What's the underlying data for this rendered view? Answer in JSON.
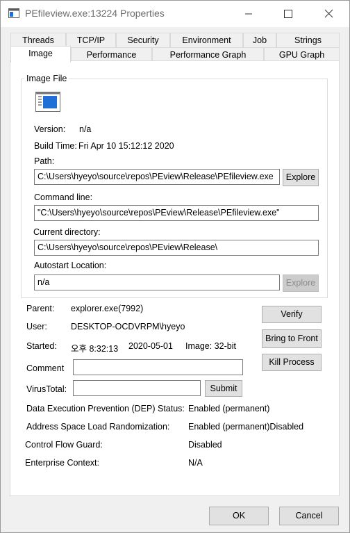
{
  "window": {
    "title": "PEfileview.exe:13224 Properties"
  },
  "tabs_row1": [
    "Threads",
    "TCP/IP",
    "Security",
    "Environment",
    "Job",
    "Strings"
  ],
  "tabs_row2": [
    "Image",
    "Performance",
    "Performance Graph",
    "GPU Graph"
  ],
  "image_file": {
    "group_title": "Image File",
    "version_label": "Version:",
    "version_value": "n/a",
    "build_time_label": "Build Time:",
    "build_time_value": "Fri Apr 10 15:12:12 2020",
    "path_label": "Path:",
    "path_value": "C:\\Users\\hyeyo\\source\\repos\\PEview\\Release\\PEfileview.exe",
    "explore_label": "Explore",
    "command_line_label": "Command line:",
    "command_line_value": "\"C:\\Users\\hyeyo\\source\\repos\\PEview\\Release\\PEfileview.exe\"",
    "current_dir_label": "Current directory:",
    "current_dir_value": "C:\\Users\\hyeyo\\source\\repos\\PEview\\Release\\",
    "autostart_label": "Autostart Location:",
    "autostart_value": "n/a",
    "autostart_explore_label": "Explore"
  },
  "process": {
    "parent_label": "Parent:",
    "parent_value": "explorer.exe(7992)",
    "user_label": "User:",
    "user_value": "DESKTOP-OCDVRPM\\hyeyo",
    "started_label": "Started:",
    "started_time": "오후 8:32:13",
    "started_date": "2020-05-01",
    "image_bits": "Image: 32-bit",
    "comment_label": "Comment",
    "comment_value": "",
    "virustotal_label": "VirusTotal:",
    "virustotal_value": "",
    "submit_label": "Submit",
    "verify_label": "Verify",
    "bring_to_front_label": "Bring to Front",
    "kill_process_label": "Kill Process"
  },
  "security": {
    "dep_label": "Data Execution Prevention (DEP) Status:",
    "dep_value": "Enabled (permanent)",
    "aslr_label": "Address Space Load Randomization:",
    "aslr_value": "Enabled (permanent)Disabled",
    "cfg_label": "Control Flow Guard:",
    "cfg_value": "Disabled",
    "enterprise_label": "Enterprise Context:",
    "enterprise_value": "N/A"
  },
  "footer": {
    "ok_label": "OK",
    "cancel_label": "Cancel"
  },
  "icons": {
    "app": "application-window-icon",
    "image_file": "executable-file-icon",
    "minimize": "minimize-icon",
    "maximize": "maximize-icon",
    "close": "close-icon"
  },
  "colors": {
    "icon_blue": "#1f6fd6",
    "panel_bg": "#ffffff",
    "window_bg": "#f0f0f0"
  }
}
